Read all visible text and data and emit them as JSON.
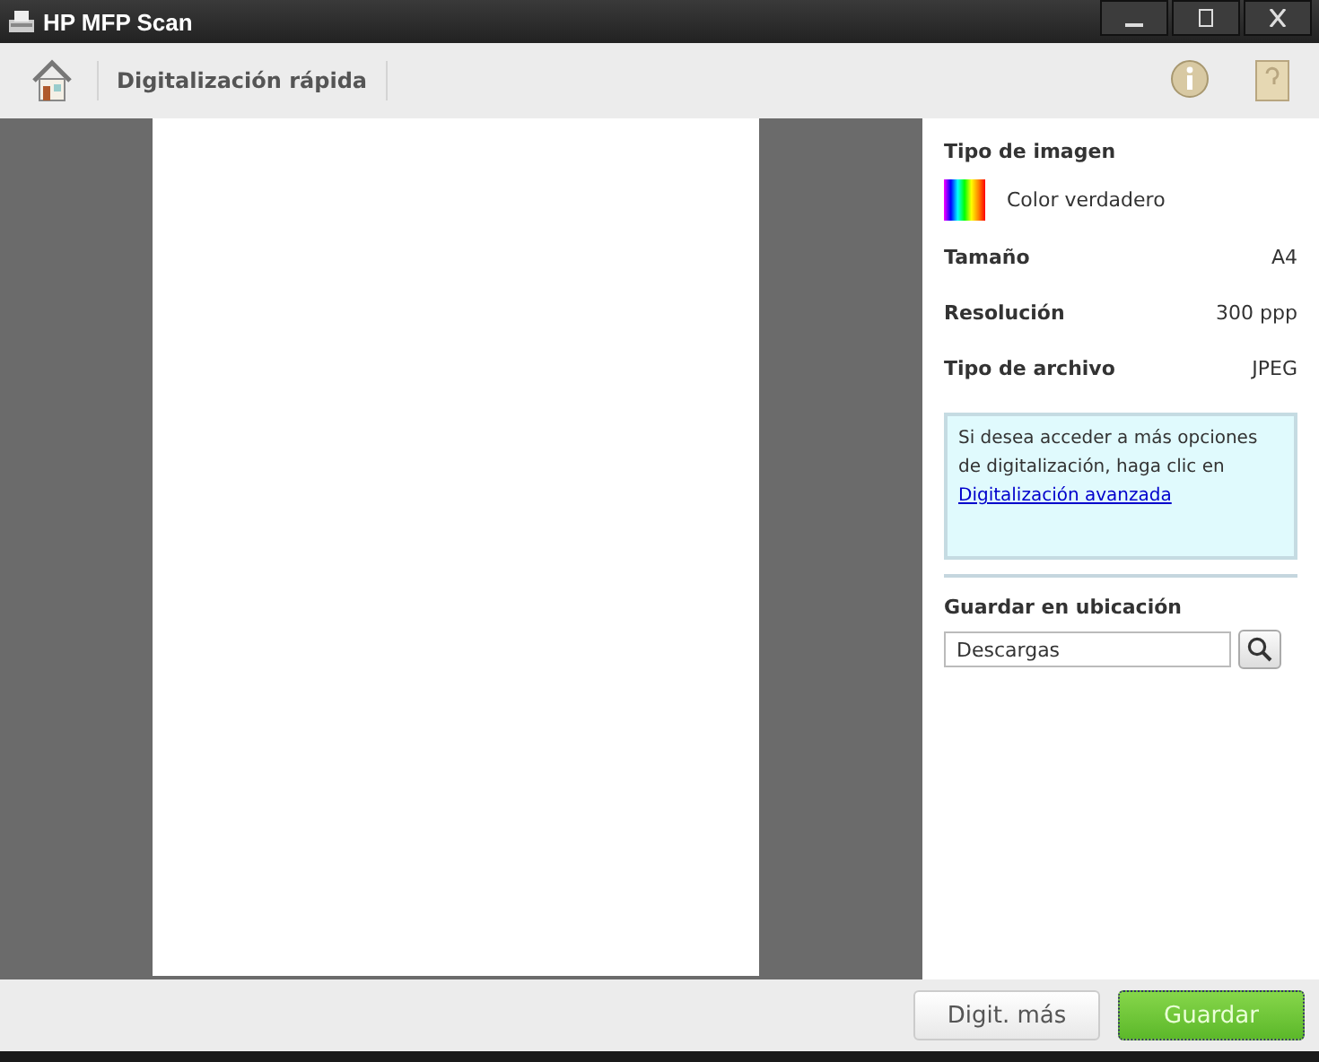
{
  "window": {
    "title": "HP MFP Scan"
  },
  "toolbar": {
    "title": "Digitalización rápida"
  },
  "settings": {
    "image_type_label": "Tipo de imagen",
    "image_type_value": "Color verdadero",
    "rows": [
      {
        "label": "Tamaño",
        "value": "A4"
      },
      {
        "label": "Resolución",
        "value": "300 ppp"
      },
      {
        "label": "Tipo de archivo",
        "value": "JPEG"
      }
    ]
  },
  "info": {
    "text": "Si desea acceder a más opciones de digitalización, haga clic en",
    "link": "Digitalización avanzada"
  },
  "save_location": {
    "label": "Guardar en ubicación",
    "value": "Descargas"
  },
  "buttons": [
    {
      "label": "Digit. más",
      "kind": "secondary"
    },
    {
      "label": "Guardar",
      "kind": "primary"
    }
  ]
}
